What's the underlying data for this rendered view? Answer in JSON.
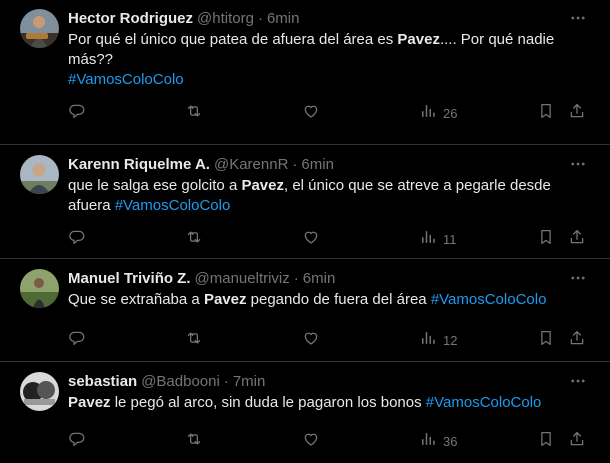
{
  "tweets": [
    {
      "name": "Hector Rodriguez",
      "handle": "@htitorg",
      "sep": "·",
      "time": "6min",
      "text_parts": [
        {
          "t": "Por qué el único que patea de afuera del área es "
        },
        {
          "t": "Pavez",
          "b": true
        },
        {
          "t": ".... Por qué nadie más??"
        },
        {
          "br": true
        },
        {
          "t": "#VamosColoColo",
          "tag": true
        }
      ],
      "views": "26"
    },
    {
      "name": "Karenn Riquelme A.",
      "handle": "@KarennR",
      "sep": "·",
      "time": "6min",
      "text_parts": [
        {
          "t": "que le salga ese golcito a "
        },
        {
          "t": "Pavez",
          "b": true
        },
        {
          "t": ", el único que se atreve a pegarle desde afuera  "
        },
        {
          "t": "#VamosColoColo",
          "tag": true
        }
      ],
      "views": "11"
    },
    {
      "name": "Manuel Triviño Z.",
      "handle": "@manueltriviz",
      "sep": "·",
      "time": "6min",
      "text_parts": [
        {
          "t": "Que se extrañaba a "
        },
        {
          "t": "Pavez",
          "b": true
        },
        {
          "t": " pegando de fuera del área "
        },
        {
          "t": "#VamosColoColo",
          "tag": true
        }
      ],
      "views": "12"
    },
    {
      "name": "sebastian",
      "handle": "@Badbooni",
      "sep": "·",
      "time": "7min",
      "text_parts": [
        {
          "t": "Pavez",
          "b": true
        },
        {
          "t": " le pegó al arco, sin duda le pagaron los bonos  "
        },
        {
          "t": "#VamosColoColo",
          "tag": true
        }
      ],
      "views": "36"
    }
  ],
  "icons": [
    "reply-icon",
    "retweet-icon",
    "like-icon",
    "views-icon",
    "bookmark-icon",
    "share-icon",
    "more-icon"
  ],
  "colors": {
    "background": "#000000",
    "text": "#e7e9ea",
    "muted": "#71767b",
    "link": "#1d9bf0",
    "divider": "#2f3336"
  }
}
